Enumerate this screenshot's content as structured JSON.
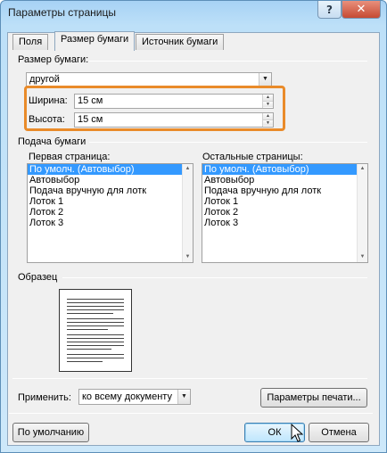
{
  "window": {
    "title": "Параметры страницы",
    "help": "?",
    "close": "✕"
  },
  "tabs": [
    {
      "label": "Поля",
      "active": false
    },
    {
      "label": "Размер бумаги",
      "active": true
    },
    {
      "label": "Источник бумаги",
      "active": false
    }
  ],
  "paper_size": {
    "section_label": "Размер бумаги:",
    "selected": "другой",
    "width_label": "Ширина:",
    "width_value": "15 см",
    "height_label": "Высота:",
    "height_value": "15 см"
  },
  "paper_source": {
    "section_label": "Подача бумаги",
    "first_page_label": "Первая страница:",
    "other_pages_label": "Остальные страницы:",
    "first_page_items": [
      "По умолч. (Автовыбор)",
      "Автовыбор",
      "Подача вручную для лотк",
      "Лоток 1",
      "Лоток 2",
      "Лоток 3"
    ],
    "other_pages_items": [
      "По умолч. (Автовыбор)",
      "Автовыбор",
      "Подача вручную для лотк",
      "Лоток 1",
      "Лоток 2",
      "Лоток 3"
    ],
    "first_page_selected": "По умолч. (Автовыбор)",
    "other_pages_selected": "По умолч. (Автовыбор)"
  },
  "preview": {
    "section_label": "Образец"
  },
  "apply": {
    "label": "Применить:",
    "value": "ко всему документу",
    "print_options_button": "Параметры печати..."
  },
  "footer": {
    "default_button": "По умолчанию",
    "ok_button": "ОК",
    "cancel_button": "Отмена"
  },
  "colors": {
    "highlight": "#e98b2a",
    "selection": "#3399ff"
  }
}
